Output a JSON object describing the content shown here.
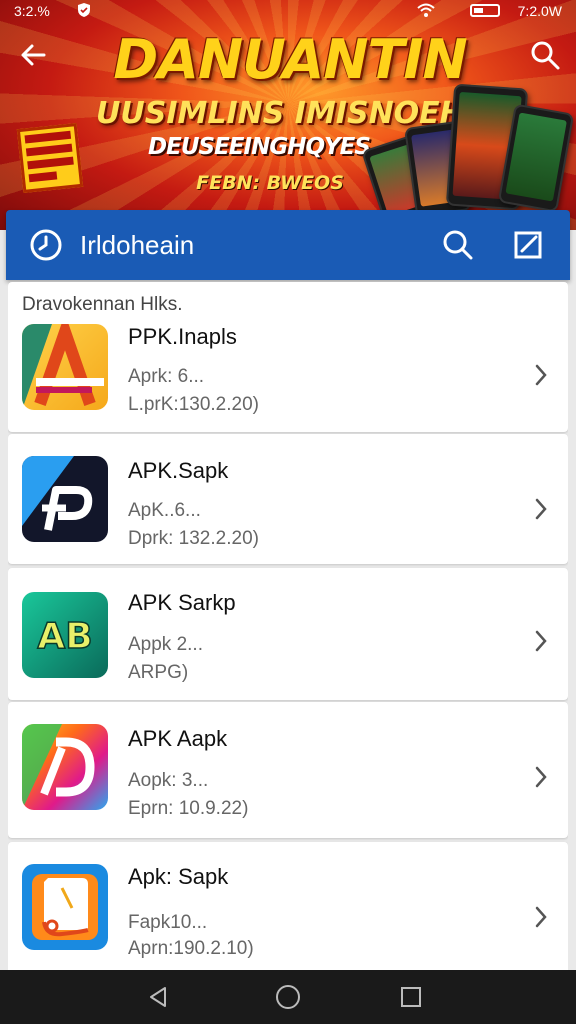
{
  "status": {
    "time": "3:2.% ",
    "right": "7:2.0W"
  },
  "banner": {
    "title": "DANUANTIN",
    "subtitle": "UUSIMLINS IMISNOEHAN",
    "subtitle2": "DEUSEEINGHQYES",
    "tag": "FEBN: BWEOS"
  },
  "header": {
    "title": "Irldoheain"
  },
  "section_label": "Dravokennan Hlks.",
  "apps": [
    {
      "name": "PPK.Inapls",
      "meta1": "Aprk: 6...",
      "meta2": "L.prK:130.2.20)",
      "icon": "a-arrow-icon"
    },
    {
      "name": "APK.Sapk",
      "meta1": "ApK..6...",
      "meta2": "Dprk: 132.2.20)",
      "icon": "p-tile-icon"
    },
    {
      "name": "APK Sarkp",
      "meta1": "Appk 2...",
      "meta2": "ARPG)",
      "icon": "ab-tile-icon"
    },
    {
      "name": "APK Aapk",
      "meta1": "Aopk: 3...",
      "meta2": "Eprn: 10.9.22)",
      "icon": "d-rainbow-icon"
    },
    {
      "name": "Apk: Sapk",
      "meta1": "Fapk10...",
      "meta2": "Aprn:190.2.10)",
      "icon": "doc-scroll-icon"
    }
  ],
  "colors": {
    "header": "#1a5bb5",
    "banner": "#c41a12",
    "title": "#ffd21a"
  }
}
